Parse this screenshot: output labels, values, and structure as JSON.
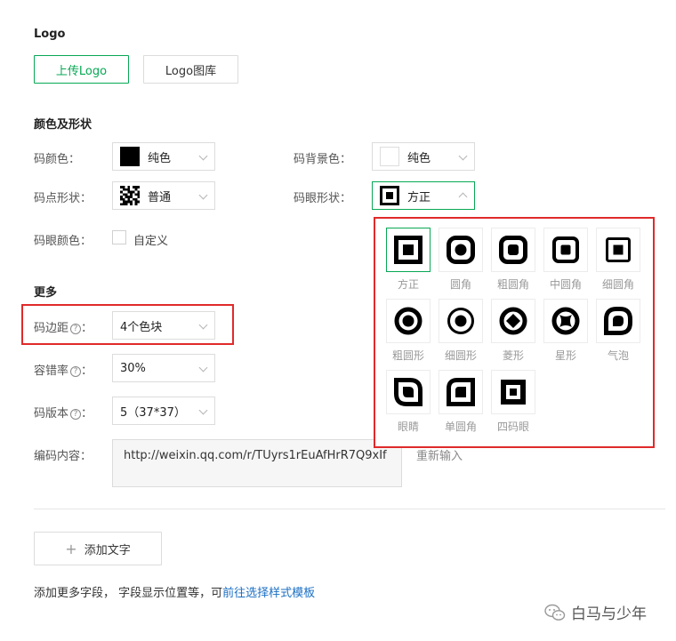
{
  "logo": {
    "title": "Logo",
    "upload_label": "上传Logo",
    "library_label": "Logo图库"
  },
  "color_shape": {
    "title": "颜色及形状",
    "code_color": {
      "label": "码颜色：",
      "value": "纯色",
      "swatch": "#000000"
    },
    "bg_color": {
      "label": "码背景色：",
      "value": "纯色",
      "swatch": "#ffffff"
    },
    "dot_shape": {
      "label": "码点形状：",
      "value": "普通"
    },
    "eye_shape": {
      "label": "码眼形状：",
      "value": "方正"
    },
    "eye_color": {
      "label": "码眼颜色：",
      "checkbox_label": "自定义"
    }
  },
  "more": {
    "title": "更多",
    "margin": {
      "label": "码边距",
      "suffix": "：",
      "value": "4个色块"
    },
    "error_rate": {
      "label": "容错率",
      "suffix": "：",
      "value": "30%"
    },
    "version": {
      "label": "码版本",
      "suffix": "：",
      "value": "5（37*37）"
    },
    "content": {
      "label": "编码内容：",
      "value": "http://weixin.qq.com/r/TUyrs1rEuAfHrR7Q9xIf",
      "reinput_label": "重新输入"
    }
  },
  "help_icon": "?",
  "eye_options": [
    {
      "label": "方正",
      "icon": "square-eye-icon",
      "selected": true
    },
    {
      "label": "圆角",
      "icon": "rounded-eye-icon"
    },
    {
      "label": "粗圆角",
      "icon": "thick-rounded-eye-icon"
    },
    {
      "label": "中圆角",
      "icon": "medium-rounded-eye-icon"
    },
    {
      "label": "细圆角",
      "icon": "thin-rounded-eye-icon"
    },
    {
      "label": "粗圆形",
      "icon": "thick-circle-eye-icon"
    },
    {
      "label": "细圆形",
      "icon": "thin-circle-eye-icon"
    },
    {
      "label": "菱形",
      "icon": "diamond-eye-icon"
    },
    {
      "label": "星形",
      "icon": "star-eye-icon"
    },
    {
      "label": "气泡",
      "icon": "bubble-eye-icon"
    },
    {
      "label": "眼睛",
      "icon": "eye-shape-icon"
    },
    {
      "label": "单圆角",
      "icon": "single-rounded-eye-icon"
    },
    {
      "label": "四码眼",
      "icon": "four-eye-icon"
    }
  ],
  "add_text": {
    "plus": "+",
    "label": "添加文字"
  },
  "footer": {
    "text": "添加更多字段， 字段显示位置等，可",
    "link": "前往选择样式模板"
  },
  "watermark": {
    "text": "白马与少年",
    "icon": "wechat-icon"
  }
}
